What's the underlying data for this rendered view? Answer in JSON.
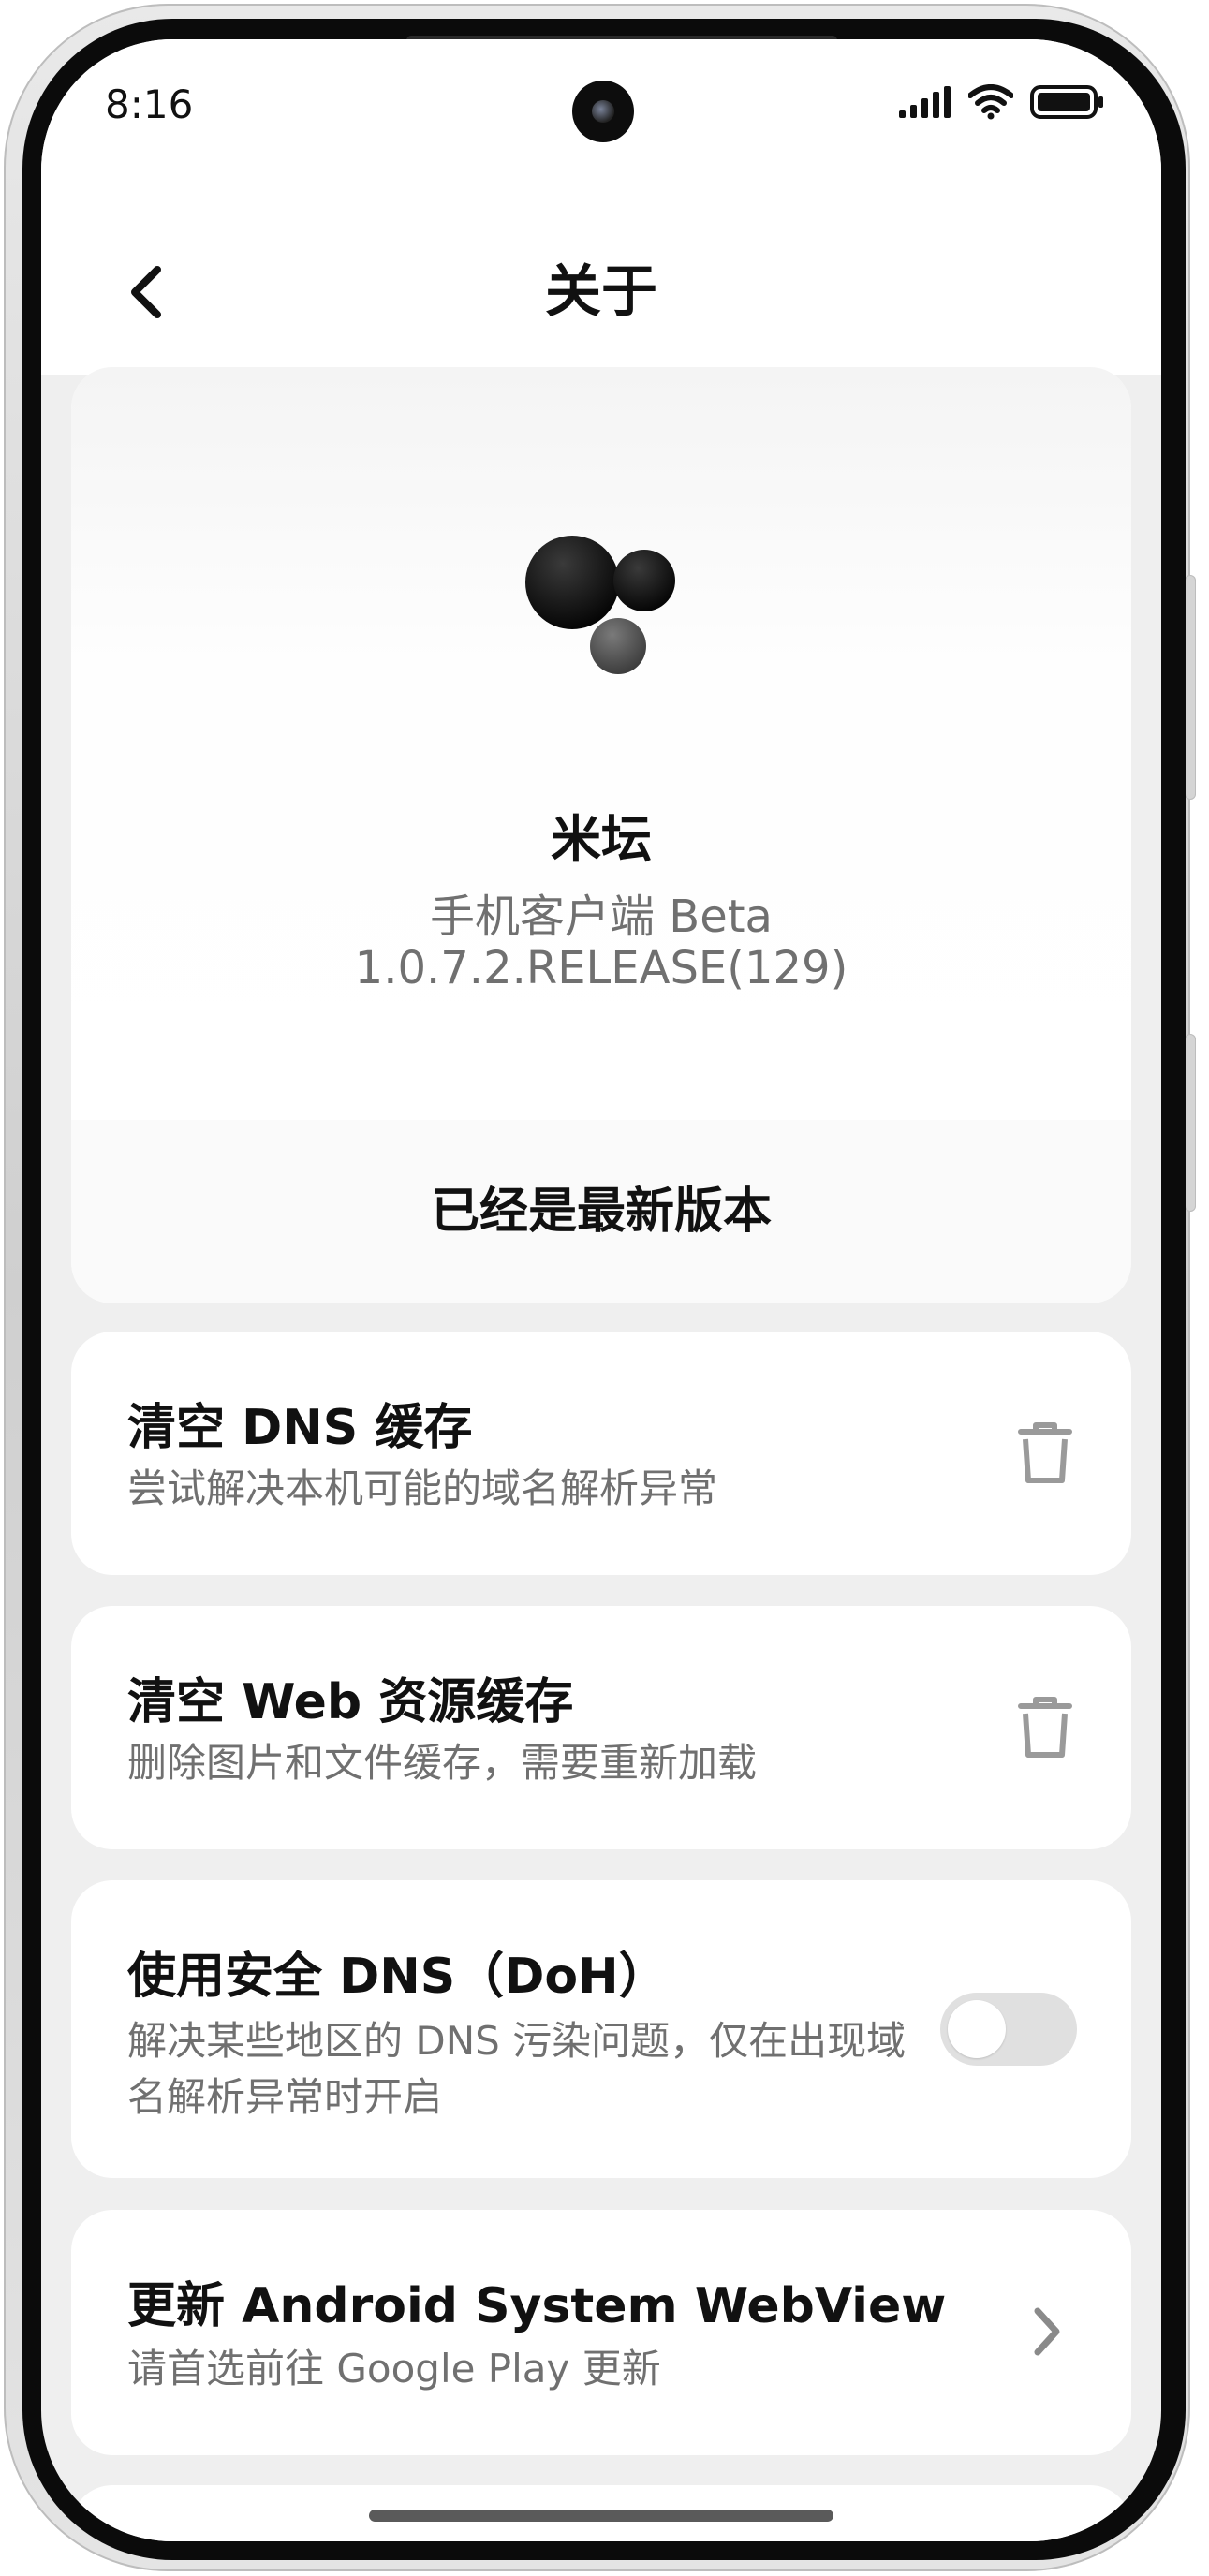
{
  "status_bar": {
    "time": "8:16"
  },
  "app_bar": {
    "title": "关于"
  },
  "about": {
    "app_name": "米坛",
    "subtitle": "手机客户端 Beta",
    "version": "1.0.7.2.RELEASE(129)",
    "update_status": "已经是最新版本"
  },
  "settings": [
    {
      "title": "清空 DNS 缓存",
      "desc": "尝试解决本机可能的域名解析异常",
      "control": "trash-icon"
    },
    {
      "title": "清空 Web 资源缓存",
      "desc": "删除图片和文件缓存，需要重新加载",
      "control": "trash-icon"
    },
    {
      "title": "使用安全 DNS（DoH）",
      "desc": "解决某些地区的 DNS 污染问题，仅在出现域名解析异常时开启",
      "control": "toggle",
      "enabled": false
    },
    {
      "title": "更新 Android System WebView",
      "desc": "请首选前往 Google Play 更新",
      "control": "chevron-right-icon"
    }
  ],
  "colors": {
    "background": "#efefef",
    "card": "#ffffff",
    "primary_text": "#111111",
    "secondary_text": "#707070",
    "toggle_off": "#e0e0e0"
  }
}
